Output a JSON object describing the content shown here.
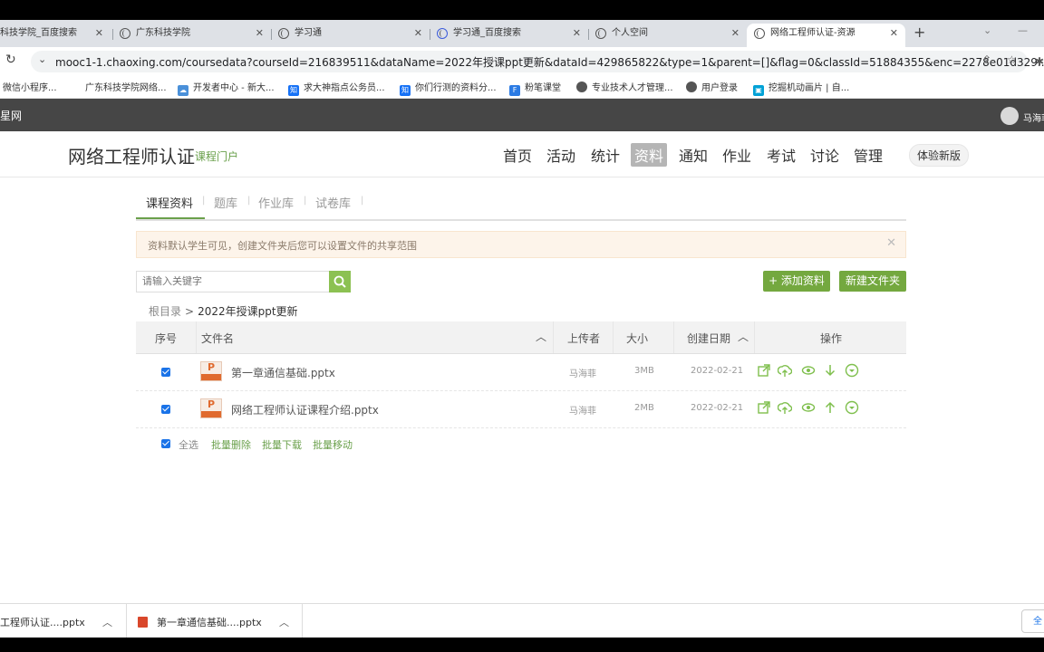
{
  "browser": {
    "tabs": [
      {
        "label": "科技学院_百度搜索",
        "icon": "paw-icon"
      },
      {
        "label": "广东科技学院",
        "icon": "globe-icon"
      },
      {
        "label": "学习通",
        "icon": "globe-icon"
      },
      {
        "label": "学习通_百度搜索",
        "icon": "paw-icon"
      },
      {
        "label": "个人空间",
        "icon": "globe-icon"
      },
      {
        "label": "网络工程师认证-资源",
        "icon": "globe-icon",
        "active": true
      }
    ],
    "url": "mooc1-1.chaoxing.com/coursedata?courseId=216839511&dataName=2022年授课ppt更新&dataId=429865822&type=1&parent=[]&flag=0&classId=51884355&enc=2278e01d329...",
    "bookmarks": [
      "微信小程序...",
      "广东科技学院网络...",
      "开发者中心 - 新大...",
      "求大神指点公务员...",
      "你们行测的资料分...",
      "粉笔课堂",
      "专业技术人才管理...",
      "用户登录",
      "挖掘机动画片 | 自..."
    ]
  },
  "site": {
    "logo": "星网",
    "user": "马海菲"
  },
  "course": {
    "title": "网络工程师认证",
    "subtitle": "课程门户",
    "nav": [
      "首页",
      "活动",
      "统计",
      "资料",
      "通知",
      "作业",
      "考试",
      "讨论",
      "管理"
    ],
    "active_nav": "资料",
    "new_version": "体验新版"
  },
  "resources": {
    "subtabs": [
      "课程资料",
      "题库",
      "作业库",
      "试卷库"
    ],
    "notice": "资料默认学生可见，创建文件夹后您可以设置文件的共享范围",
    "search_placeholder": "请输入关键字",
    "add_button": "+ 添加资料",
    "new_folder_button": "新建文件夹",
    "breadcrumb_root": "根目录",
    "breadcrumb_sep": ">",
    "breadcrumb_current": "2022年授课ppt更新",
    "columns": [
      "序号",
      "文件名",
      "上传者",
      "大小",
      "创建日期",
      "操作"
    ],
    "files": [
      {
        "name": "第一章通信基础.pptx",
        "uploader": "马海菲",
        "size": "3MB",
        "date": "2022-02-21",
        "checked": true
      },
      {
        "name": "网络工程师认证课程介绍.pptx",
        "uploader": "马海菲",
        "size": "2MB",
        "date": "2022-02-21",
        "checked": true
      }
    ],
    "select_all": "全选",
    "batch_delete": "批量删除",
    "batch_download": "批量下载",
    "batch_move": "批量移动"
  },
  "downloads": [
    {
      "name": "工程师认证....pptx"
    },
    {
      "name": "第一章通信基础....pptx"
    }
  ],
  "downloads_show_all": "全",
  "colors": {
    "accent": "#74a83f",
    "header": "#464646",
    "notice_bg": "#fdf4ea"
  }
}
